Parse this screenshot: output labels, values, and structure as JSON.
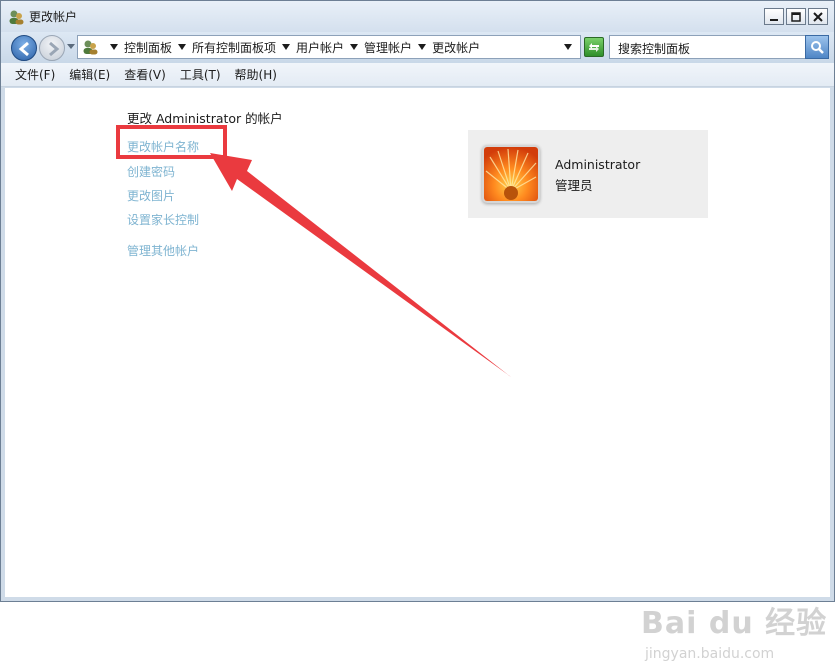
{
  "window": {
    "title": "更改帐户"
  },
  "address": {
    "crumbs": [
      "控制面板",
      "所有控制面板项",
      "用户帐户",
      "管理帐户",
      "更改帐户"
    ]
  },
  "search": {
    "placeholder": "搜索控制面板"
  },
  "menu": [
    "文件(F)",
    "编辑(E)",
    "查看(V)",
    "工具(T)",
    "帮助(H)"
  ],
  "main": {
    "heading": "更改 Administrator 的帐户",
    "tasks": [
      "更改帐户名称",
      "创建密码",
      "更改图片",
      "设置家长控制",
      "管理其他帐户"
    ]
  },
  "account": {
    "name": "Administrator",
    "role": "管理员"
  },
  "watermark": {
    "main": "Bai du 经验",
    "sub": "jingyan.baidu.com"
  },
  "colors": {
    "link": "#7fb4d1",
    "annotation": "#ea3a3f",
    "card_bg": "#eeeeee"
  }
}
